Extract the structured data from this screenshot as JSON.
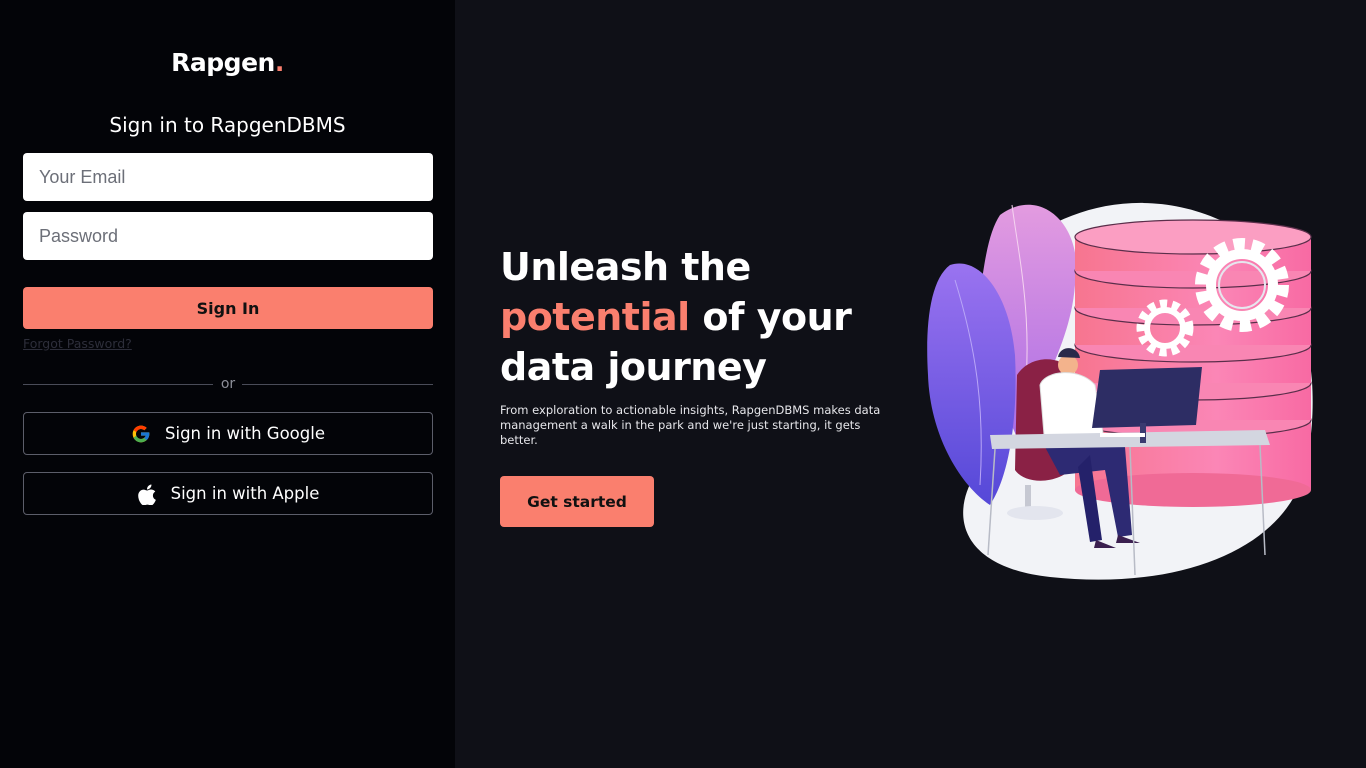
{
  "brand": {
    "name": "Rapgen",
    "dot": "."
  },
  "login": {
    "heading": "Sign in to RapgenDBMS",
    "email_placeholder": "Your Email",
    "password_placeholder": "Password",
    "signin_label": "Sign In",
    "forgot_label": "Forgot Password?",
    "divider_label": "or",
    "google_label": "Sign in with Google",
    "google_icon": "google-icon",
    "apple_label": "Sign in with Apple",
    "apple_icon": "apple-icon"
  },
  "hero": {
    "title_line1": "Unleash the",
    "title_accent": "potential",
    "title_rest": " of your",
    "title_line3": "data journey",
    "description": "From exploration to actionable insights, RapgenDBMS makes data management a walk in the park and we're just starting, it gets better.",
    "cta_label": "Get started"
  },
  "colors": {
    "accent": "#fa7f6e",
    "left_panel_bg": "#030408",
    "right_panel_bg": "#0f1017"
  }
}
